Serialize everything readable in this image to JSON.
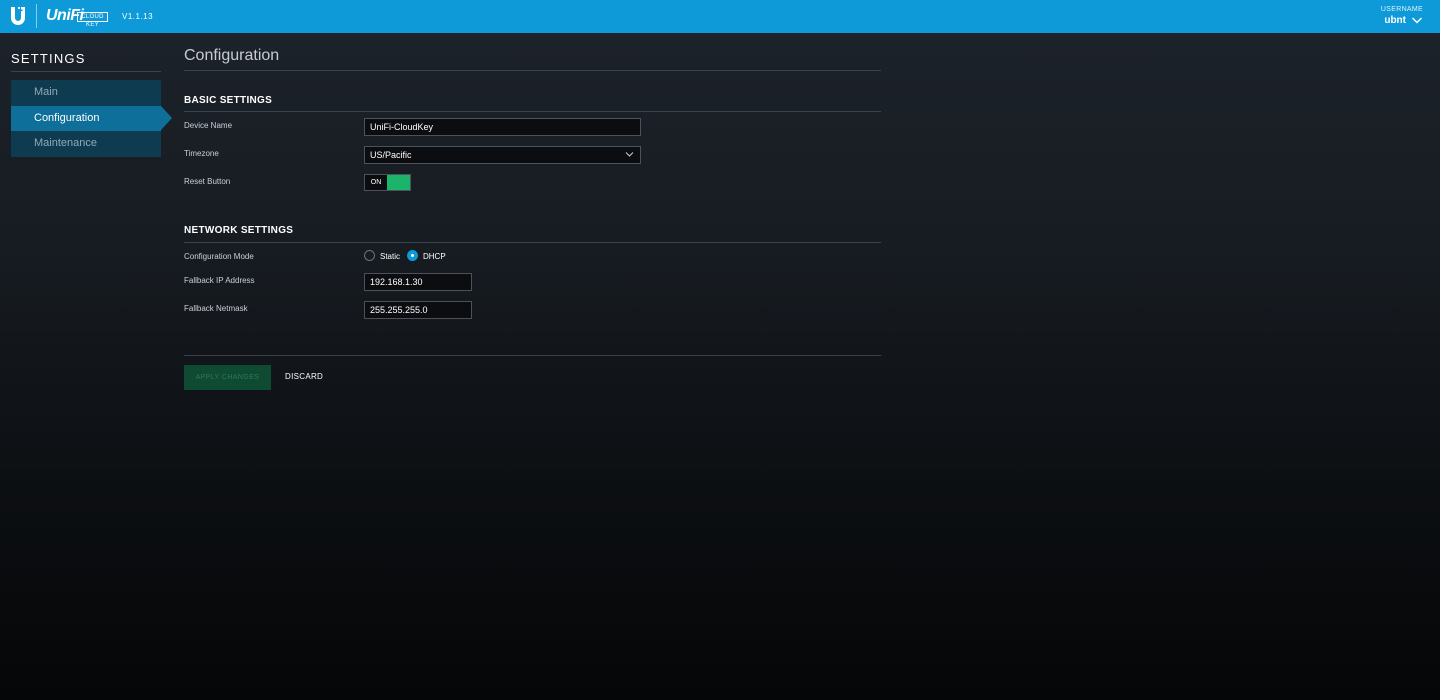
{
  "header": {
    "brand": "UniFi",
    "brand_badge": "CLOUD KEY",
    "version": "V1.1.13",
    "user_caption": "USERNAME",
    "username": "ubnt"
  },
  "sidebar": {
    "title": "SETTINGS",
    "items": [
      {
        "label": "Main",
        "active": false
      },
      {
        "label": "Configuration",
        "active": true
      },
      {
        "label": "Maintenance",
        "active": false
      }
    ]
  },
  "main": {
    "title": "Configuration",
    "basic": {
      "heading": "BASIC SETTINGS",
      "device_name_label": "Device Name",
      "device_name_value": "UniFi-CloudKey",
      "timezone_label": "Timezone",
      "timezone_value": "US/Pacific",
      "reset_button_label": "Reset Button",
      "reset_button_state": "ON"
    },
    "network": {
      "heading": "NETWORK SETTINGS",
      "config_mode_label": "Configuration Mode",
      "mode_options": [
        "Static",
        "DHCP"
      ],
      "mode_selected": "DHCP",
      "fallback_ip_label": "Fallback IP Address",
      "fallback_ip_value": "192.168.1.30",
      "fallback_netmask_label": "Fallback Netmask",
      "fallback_netmask_value": "255.255.255.0"
    },
    "actions": {
      "apply_label": "APPLY CHANGES",
      "discard_label": "DISCARD"
    }
  },
  "colors": {
    "topbar": "#0e9ad8",
    "sidebar_active": "#0e6f9a",
    "toggle_on": "#1cb46b"
  }
}
